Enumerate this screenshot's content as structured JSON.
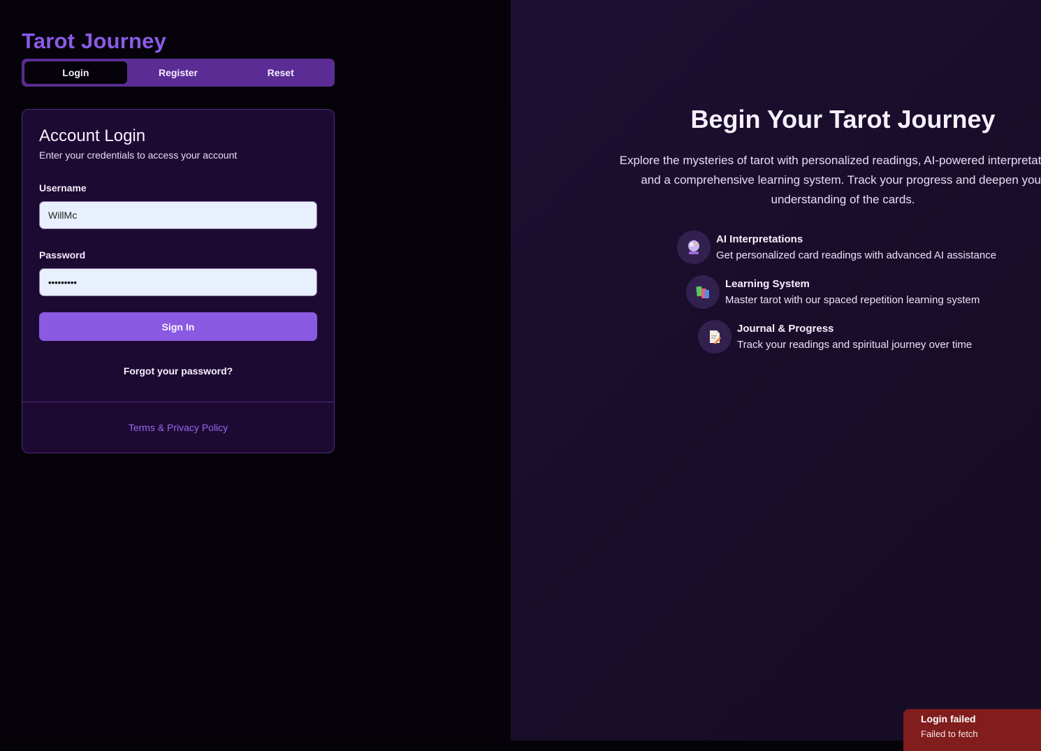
{
  "app": {
    "title": "Tarot Journey"
  },
  "tabs": [
    {
      "label": "Login",
      "active": true
    },
    {
      "label": "Register",
      "active": false
    },
    {
      "label": "Reset",
      "active": false
    }
  ],
  "login_card": {
    "title": "Account Login",
    "subtitle": "Enter your credentials to access your account",
    "username_label": "Username",
    "username_value": "WillMc",
    "password_label": "Password",
    "password_value": "•••••••••",
    "submit_label": "Sign In",
    "forgot_label": "Forgot your password?",
    "terms_label": "Terms & Privacy Policy"
  },
  "hero": {
    "title": "Begin Your Tarot Journey",
    "description": "Explore the mysteries of tarot with personalized readings, AI-powered interpretations, and a comprehensive learning system. Track your progress and deepen your understanding of the cards.",
    "features": [
      {
        "icon": "crystal-ball-icon",
        "title": "AI Interpretations",
        "description": "Get personalized card readings with advanced AI assistance"
      },
      {
        "icon": "books-icon",
        "title": "Learning System",
        "description": "Master tarot with our spaced repetition learning system"
      },
      {
        "icon": "memo-icon",
        "title": "Journal & Progress",
        "description": "Track your readings and spiritual journey over time"
      }
    ]
  },
  "toast": {
    "title": "Login failed",
    "message": "Failed to fetch"
  },
  "colors": {
    "accent": "#8b5ae2",
    "tab_bar": "#5b2c94",
    "card_bg": "#1d0a33",
    "toast_bg": "#821d1d"
  }
}
